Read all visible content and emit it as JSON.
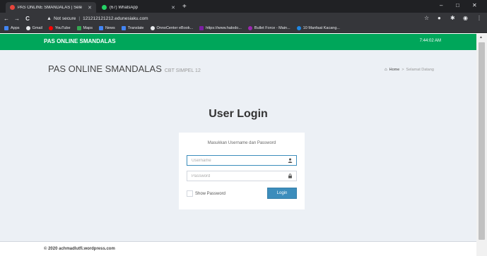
{
  "browser": {
    "tabs": [
      {
        "title": "PAS ONLINE SMANDALAS | Sele",
        "favicon_color": "#e8453c",
        "active": true
      },
      {
        "title": "(67) WhatsApp",
        "favicon_color": "#25d366",
        "active": false
      }
    ],
    "new_tab_label": "+",
    "window": {
      "minimize": "–",
      "maximize": "□",
      "close": "✕"
    },
    "nav": {
      "back": "←",
      "forward": "→",
      "reload": "C"
    },
    "address": {
      "security_label": "Not secure",
      "url": "121212121212.edunesiaku.com"
    },
    "bookmarks": [
      {
        "label": "Apps",
        "color": "#4285f4"
      },
      {
        "label": "Gmail",
        "color": "#e8eaed"
      },
      {
        "label": "YouTube",
        "color": "#ff0000"
      },
      {
        "label": "Maps",
        "color": "#34a853"
      },
      {
        "label": "News",
        "color": "#4285f4"
      },
      {
        "label": "Translate",
        "color": "#4285f4"
      },
      {
        "label": "OnnoCenter eBook...",
        "color": "#e8eaed"
      },
      {
        "label": "https://www.halodo...",
        "color": "#7b1fa2"
      },
      {
        "label": "Bullet Force - Main...",
        "color": "#9c27b0"
      },
      {
        "label": "10 Manfaat Kacang...",
        "color": "#1e88e5"
      }
    ]
  },
  "app": {
    "brand": "PAS ONLINE SMANDALAS",
    "clock": "7:44:02 AM",
    "colors": {
      "header": "#00a65a",
      "button": "#3c8dbc",
      "background": "#ecf0f5"
    }
  },
  "page": {
    "title": "PAS ONLINE SMANDALAS",
    "subtitle": "CBT SIMPEL 12",
    "breadcrumb": {
      "home": "Home",
      "current": "Selamat Datang"
    }
  },
  "login": {
    "heading": "User Login",
    "message": "Masukkan Username dan Password",
    "username_placeholder": "Username",
    "username_value": "",
    "password_placeholder": "Password",
    "password_value": "",
    "show_password_label": "Show Password",
    "show_password_checked": false,
    "submit_label": "Login"
  },
  "footer": {
    "text": "© 2020 achmadlutfi.wordpress.com"
  }
}
